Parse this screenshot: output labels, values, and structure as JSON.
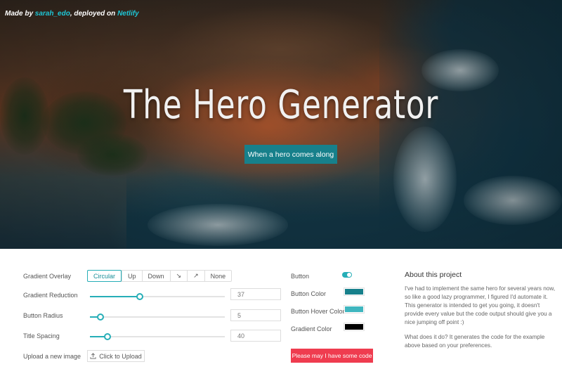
{
  "hero": {
    "credit_prefix": "Made by ",
    "credit_author": "sarah_edo",
    "credit_middle": ", deployed on ",
    "credit_host": "Netlify",
    "title": "The Hero Generator",
    "button_label": "When a hero comes along",
    "button_color": "#17808b"
  },
  "controls": {
    "gradient_overlay": {
      "label": "Gradient Overlay",
      "options": [
        "Circular",
        "Up",
        "Down",
        "↘",
        "↗",
        "None"
      ],
      "selected": "Circular"
    },
    "gradient_reduction": {
      "label": "Gradient Reduction",
      "value": "37",
      "fraction": 0.37
    },
    "button_radius": {
      "label": "Button Radius",
      "value": "5",
      "fraction": 0.08
    },
    "title_spacing": {
      "label": "Title Spacing",
      "value": "40",
      "fraction": 0.13
    },
    "upload": {
      "label": "Upload a new image",
      "button_label": "Click to Upload"
    }
  },
  "colors": {
    "button": {
      "label": "Button",
      "toggle_on": true
    },
    "button_color": {
      "label": "Button Color",
      "value": "#17808b"
    },
    "button_hover_color": {
      "label": "Button Hover Color",
      "value": "#3fb6bf"
    },
    "gradient_color": {
      "label": "Gradient Color",
      "value": "#000000"
    },
    "code_button_label": "Please may I have some code",
    "code_button_color": "#ef3c4f",
    "accent": "#26aeb7"
  },
  "about": {
    "title": "About this project",
    "p1": "I've had to implement the same hero for several years now, so like a good lazy programmer, I figured I'd automate it. This generator is intended to get you going, it doesn't provide every value but the code output should give you a nice jumping off point :)",
    "p2": "What does it do? It generates the code for the example above based on your preferences."
  }
}
